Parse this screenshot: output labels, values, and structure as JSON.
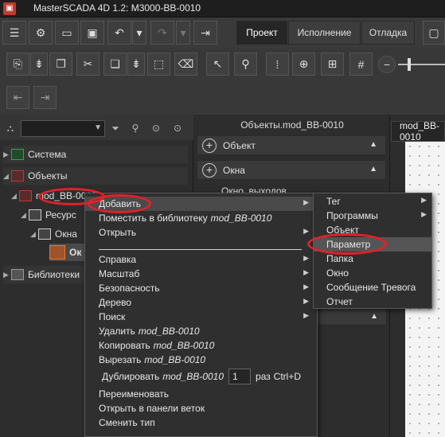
{
  "app": {
    "title": "MasterSCADA 4D 1.2: M3000-BB-0010"
  },
  "toolbar": {
    "tabs": [
      "Проект",
      "Исполнение",
      "Отладка"
    ]
  },
  "tree_panel": {
    "items": [
      {
        "label": "Система"
      },
      {
        "label": "Объекты"
      },
      {
        "label": "mod_BB-0010"
      },
      {
        "label": "Ресурс"
      },
      {
        "label": "Окна"
      },
      {
        "label": "Ок"
      },
      {
        "label": "Библиотеки"
      }
    ]
  },
  "object_panel": {
    "header": "Объекты.mod_BB-0010",
    "sections": [
      {
        "label": "Объект"
      },
      {
        "label": "Окна"
      }
    ],
    "window_item": "Окно_выходов"
  },
  "editor_tab": {
    "label": "mod_BB-0010"
  },
  "context_menu": {
    "add": "Добавить",
    "place_in_lib": "Поместить в библиотеку",
    "place_in_lib_target": "mod_BB-0010",
    "open": "Открыть",
    "help": "Справка",
    "scale": "Масштаб",
    "security": "Безопасность",
    "tree": "Дерево",
    "search": "Поиск",
    "delete": "Удалить",
    "delete_target": "mod_BB-0010",
    "copy": "Копировать",
    "copy_target": "mod_BB-0010",
    "cut": "Вырезать",
    "cut_target": "mod_BB-0010",
    "duplicate": "Дублировать",
    "duplicate_target": "mod_BB-0010",
    "duplicate_count": "1",
    "duplicate_unit": "раз",
    "duplicate_shortcut": "Ctrl+D",
    "rename": "Переименовать",
    "open_in_branch_panel": "Открыть в панели веток",
    "change_type": "Сменить тип"
  },
  "submenu": {
    "items": [
      "Тег",
      "Программы",
      "Объект",
      "Параметр",
      "Папка",
      "Окно",
      "Сообщение Тревога",
      "Отчет"
    ],
    "highlighted": "Параметр"
  },
  "colors": {
    "highlight_oval": "#e3202a",
    "object_icon": "#c0392b",
    "system_icon": "#3aa14a"
  }
}
